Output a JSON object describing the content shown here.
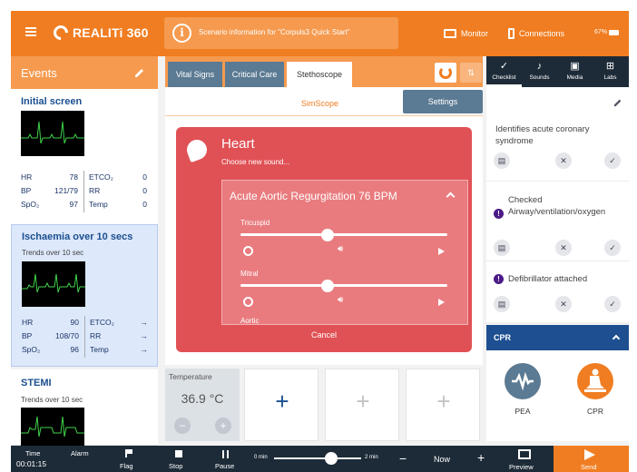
{
  "header": {
    "logo_text": "REALITi 360",
    "scenario_text": "Scenario information for \"Corpuls3 Quick Start\"",
    "monitor_label": "Monitor",
    "connections_label": "Connections",
    "battery": "67%"
  },
  "events": {
    "title": "Events",
    "cards": [
      {
        "title": "Initial screen",
        "vitals": {
          "hr_label": "HR",
          "hr": "78",
          "etco2_label": "ETCO₂",
          "etco2": "0",
          "bp_label": "BP",
          "bp": "121/79",
          "rr_label": "RR",
          "rr": "0",
          "spo2_label": "SpO₂",
          "spo2": "97",
          "temp_label": "Temp",
          "temp": "0"
        }
      },
      {
        "title": "Ischaemia over 10 secs",
        "subtitle": "Trends over 10 sec",
        "vitals": {
          "hr_label": "HR",
          "hr": "90",
          "etco2_label": "ETCO₂",
          "etco2": "→",
          "bp_label": "BP",
          "bp": "108/70",
          "rr_label": "RR",
          "rr": "→",
          "spo2_label": "SpO₂",
          "spo2": "96",
          "temp_label": "Temp",
          "temp": "→"
        }
      },
      {
        "title": "STEMI",
        "subtitle": "Trends over 10 sec"
      }
    ]
  },
  "tabs": {
    "items": [
      "Vital Signs",
      "Critical Care",
      "Stethoscope"
    ],
    "active": "Stethoscope"
  },
  "right_tabs": [
    {
      "label": "Checklist",
      "icon": "check-icon"
    },
    {
      "label": "Sounds",
      "icon": "music-note-icon"
    },
    {
      "label": "Media",
      "icon": "image-icon"
    },
    {
      "label": "Labs",
      "icon": "plus-box-icon"
    }
  ],
  "stethoscope": {
    "simscope_label": "SimScope",
    "settings_label": "Settings",
    "heart_title": "Heart",
    "heart_subtitle": "Choose new sound...",
    "sound_name": "Acute Aortic Regurgitation 76 BPM",
    "valves": [
      {
        "label": "Tricuspid",
        "level": 0.42
      },
      {
        "label": "Mitral",
        "level": 0.42
      },
      {
        "label": "Aortic"
      }
    ],
    "cancel_label": "Cancel"
  },
  "temperature": {
    "label": "Temperature",
    "value": "36.9 °C",
    "minus": "−",
    "plus": "+"
  },
  "tiles": [
    "+",
    "+",
    "+"
  ],
  "checklist": {
    "items": [
      {
        "text": "Identifies acute coronary syndrome",
        "alert": false
      },
      {
        "text": "Checked Airway/ventilation/oxygen",
        "alert": true
      },
      {
        "text": "Defibrillator attached",
        "alert": true
      }
    ]
  },
  "cpr": {
    "title": "CPR",
    "buttons": [
      {
        "label": "PEA",
        "color": "#5b7a93"
      },
      {
        "label": "CPR",
        "color": "#f07d21"
      }
    ]
  },
  "bottom": {
    "time_label": "Time",
    "time_value": "00:01:15",
    "alarm_label": "Alarm",
    "flag_label": "Flag",
    "stop_label": "Stop",
    "pause_label": "Pause",
    "timeline_start": "0 min",
    "timeline_end": "2 min",
    "minus": "−",
    "now_label": "Now",
    "plus": "+",
    "preview_label": "Preview",
    "send_label": "Send"
  },
  "colors": {
    "brand_orange": "#f07d21",
    "navy": "#1d2b38",
    "steel": "#5b7a93",
    "heart_red": "#e05155"
  }
}
